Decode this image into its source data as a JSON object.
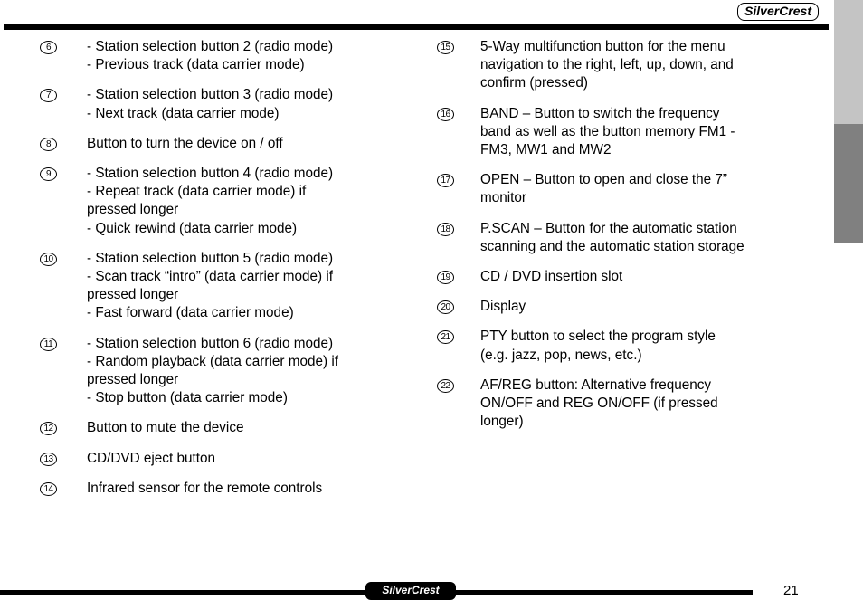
{
  "header": {
    "logo_text": "SilverCrest"
  },
  "edge_tabs": [
    {
      "name": "upper-tab",
      "color": "#c4c4c4"
    },
    {
      "name": "lower-tab",
      "color": "#808080"
    }
  ],
  "columns": {
    "left": [
      {
        "number": "6",
        "lines": [
          "- Station selection button 2 (radio mode)",
          "- Previous track (data carrier mode)"
        ]
      },
      {
        "number": "7",
        "lines": [
          "- Station selection button 3 (radio mode)",
          "- Next track (data carrier mode)"
        ]
      },
      {
        "number": "8",
        "lines": [
          "Button to turn the device on / off"
        ]
      },
      {
        "number": "9",
        "lines": [
          "- Station selection button 4 (radio mode)",
          "- Repeat track (data carrier mode) if",
          "pressed longer",
          "- Quick rewind (data carrier mode)"
        ]
      },
      {
        "number": "10",
        "lines": [
          "- Station selection button 5 (radio mode)",
          "- Scan track “intro” (data carrier mode) if",
          "pressed longer",
          "- Fast forward (data carrier mode)"
        ]
      },
      {
        "number": "11",
        "lines": [
          "- Station selection button 6 (radio mode)",
          "- Random playback (data carrier mode) if",
          "pressed longer",
          "- Stop button (data carrier mode)"
        ]
      },
      {
        "number": "12",
        "lines": [
          "Button to mute the device"
        ]
      },
      {
        "number": "13",
        "lines": [
          "CD/DVD eject button"
        ]
      },
      {
        "number": "14",
        "lines": [
          "Infrared sensor for the remote controls"
        ]
      }
    ],
    "right": [
      {
        "number": "15",
        "lines": [
          "5-Way multifunction button for the menu",
          "navigation to the right, left, up, down, and",
          "confirm (pressed)"
        ]
      },
      {
        "number": "16",
        "lines": [
          "BAND – Button to switch the frequency",
          "band as well as the button memory FM1 -",
          "FM3, MW1 and MW2"
        ]
      },
      {
        "number": "17",
        "lines": [
          "OPEN – Button to open and close the 7”",
          "monitor"
        ]
      },
      {
        "number": "18",
        "lines": [
          "P.SCAN – Button for the automatic station",
          "scanning and the automatic station storage"
        ]
      },
      {
        "number": "19",
        "lines": [
          "CD / DVD insertion slot"
        ]
      },
      {
        "number": "20",
        "lines": [
          "Display"
        ]
      },
      {
        "number": "21",
        "lines": [
          "PTY button to select the program style",
          "(e.g. jazz, pop, news, etc.)"
        ]
      },
      {
        "number": "22",
        "lines": [
          "AF/REG button: Alternative frequency",
          "ON/OFF and REG ON/OFF (if pressed",
          "longer)"
        ]
      }
    ]
  },
  "footer": {
    "logo_text": "SilverCrest",
    "page_number": "21"
  }
}
